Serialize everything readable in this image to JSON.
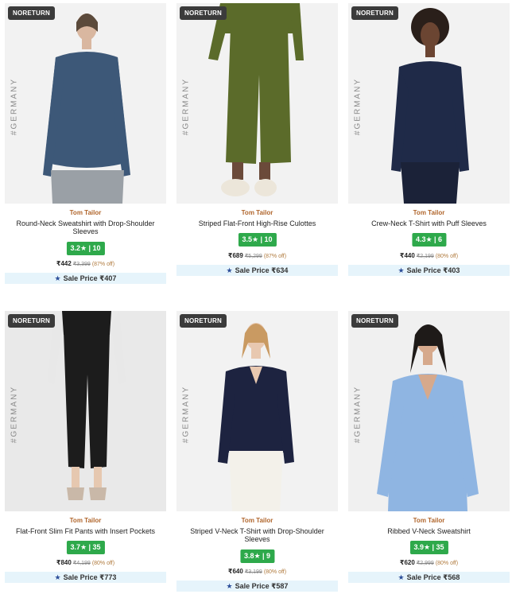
{
  "products": [
    {
      "badge": "NORETURN",
      "tag": "#GERMANY",
      "brand": "Tom Tailor",
      "title": "Round-Neck Sweatshirt with Drop-Shoulder Sleeves",
      "rating": "3.2★ | 10",
      "price": "₹442",
      "mrp": "₹3,399",
      "discount": "(87% off)",
      "sale_price": "Sale Price ₹407",
      "colors": {
        "garment": "#3d5878",
        "bottom": "#9aa0a6",
        "bg": "#f2f2f2"
      }
    },
    {
      "badge": "NORETURN",
      "tag": "#GERMANY",
      "brand": "Tom Tailor",
      "title": "Striped Flat-Front High-Rise Culottes",
      "rating": "3.5★ | 10",
      "price": "₹689",
      "mrp": "₹5,299",
      "discount": "(87% off)",
      "sale_price": "Sale Price ₹634",
      "colors": {
        "garment": "#5b6b2a",
        "bottom": "#ece6da",
        "bg": "#f2f2f2"
      }
    },
    {
      "badge": "NORETURN",
      "tag": "#GERMANY",
      "brand": "Tom Tailor",
      "title": "Crew-Neck T-Shirt with Puff Sleeves",
      "rating": "4.3★ | 6",
      "price": "₹440",
      "mrp": "₹2,199",
      "discount": "(80% off)",
      "sale_price": "Sale Price ₹403",
      "colors": {
        "garment": "#1f2a48",
        "bottom": "#1b2238",
        "bg": "#f2f2f2"
      }
    },
    {
      "badge": "NORETURN",
      "tag": "#GERMANY",
      "brand": "Tom Tailor",
      "title": "Flat-Front Slim Fit Pants with Insert Pockets",
      "rating": "3.7★ | 35",
      "price": "₹840",
      "mrp": "₹4,199",
      "discount": "(80% off)",
      "sale_price": "Sale Price ₹773",
      "colors": {
        "garment": "#1c1c1c",
        "bottom": "#1c1c1c",
        "bg": "#e9e9e9"
      }
    },
    {
      "badge": "NORETURN",
      "tag": "#GERMANY",
      "brand": "Tom Tailor",
      "title": "Striped V-Neck T-Shirt with Drop-Shoulder Sleeves",
      "rating": "3.8★ | 9",
      "price": "₹640",
      "mrp": "₹3,199",
      "discount": "(80% off)",
      "sale_price": "Sale Price ₹587",
      "colors": {
        "garment": "#1d2340",
        "bottom": "#f3f1ea",
        "bg": "#f2f2f2"
      }
    },
    {
      "badge": "NORETURN",
      "tag": "#GERMANY",
      "brand": "Tom Tailor",
      "title": "Ribbed V-Neck Sweatshirt",
      "rating": "3.9★ | 35",
      "price": "₹620",
      "mrp": "₹2,999",
      "discount": "(80% off)",
      "sale_price": "Sale Price ₹568",
      "colors": {
        "garment": "#8fb5e2",
        "bottom": "#8fb5e2",
        "bg": "#f0f0f0"
      }
    }
  ]
}
